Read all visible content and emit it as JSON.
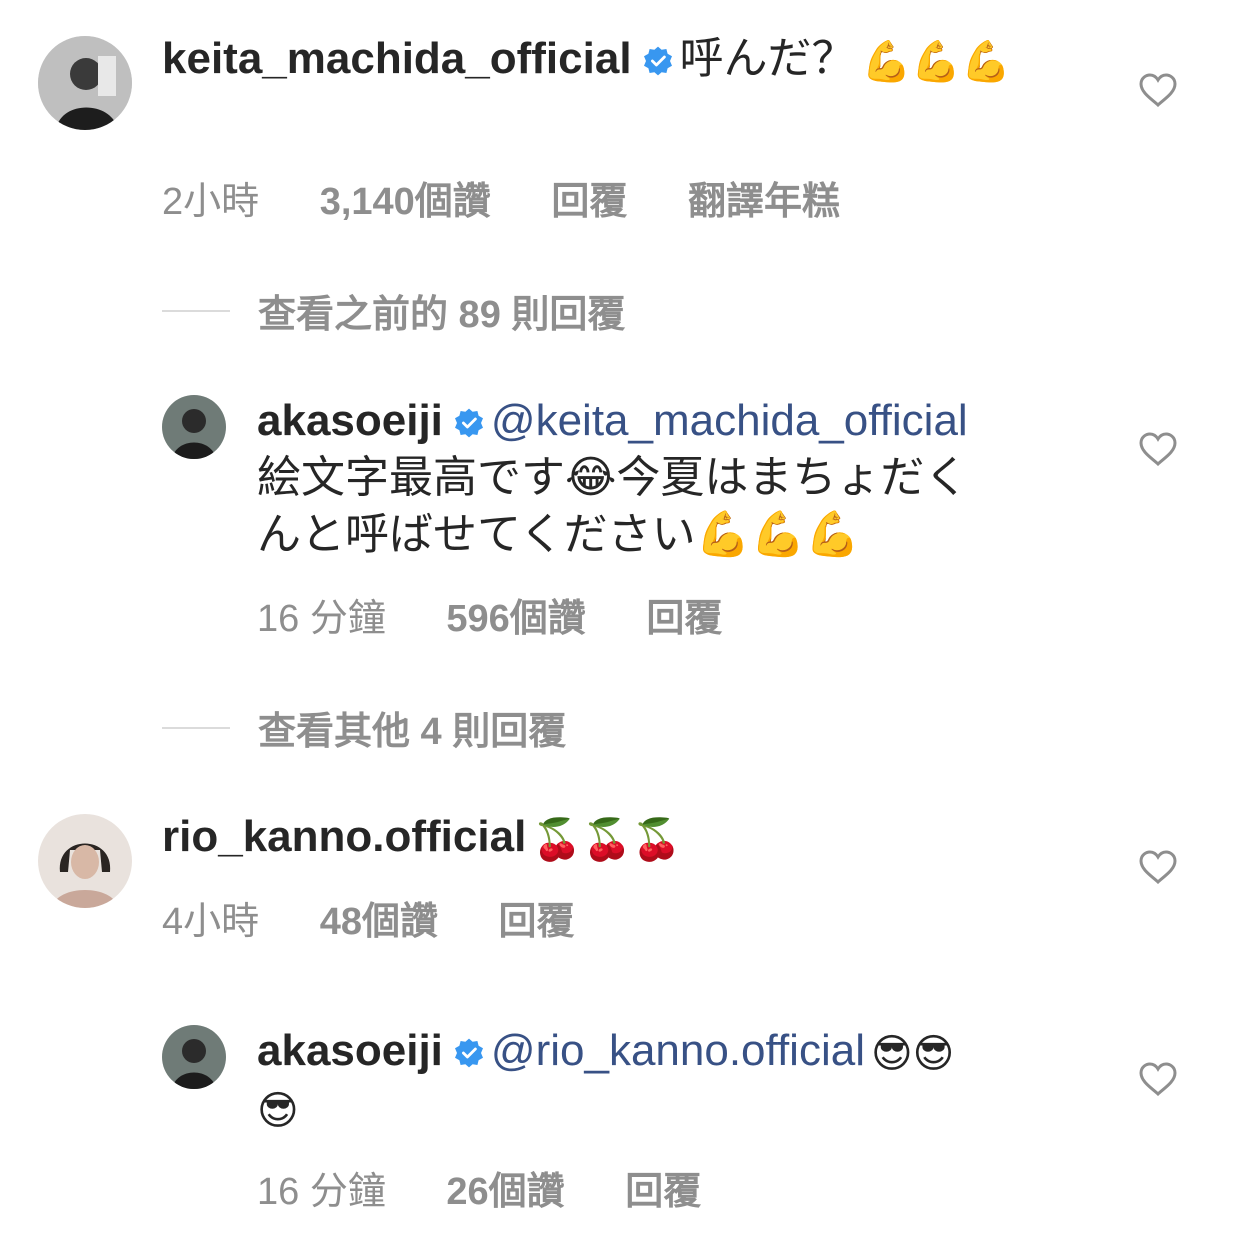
{
  "comments": [
    {
      "username": "keita_machida_official",
      "verified": true,
      "text": "呼んだ？",
      "emojis": "💪💪💪",
      "time": "2小時",
      "likes": "3,140個讚",
      "reply": "回覆",
      "translate": "翻譯年糕",
      "heart_icon": "heart-outline-icon"
    },
    {
      "view_replies": "查看之前的 89 則回覆"
    },
    {
      "username": "akasoeiji",
      "verified": true,
      "mention": "@keita_machida_official",
      "text_line1": "絵文字最高です😂今夏はまちょだく",
      "text_line2": "んと呼ばせてください💪💪💪",
      "time": "16 分鐘",
      "likes": "596個讚",
      "reply": "回覆"
    },
    {
      "view_replies": "查看其他 4 則回覆"
    },
    {
      "username": "rio_kanno.official",
      "verified": false,
      "emojis": "🍒🍒🍒",
      "time": "4小時",
      "likes": "48個讚",
      "reply": "回覆"
    },
    {
      "username": "akasoeiji",
      "verified": true,
      "mention": "@rio_kanno.official",
      "emojis_line1": "😎😎",
      "emojis_line2": "😎",
      "time": "16 分鐘",
      "likes": "26個讚",
      "reply": "回覆"
    }
  ],
  "colors": {
    "text": "#262626",
    "meta": "#8e8e8e",
    "mention": "#385185",
    "verified": "#3897f0",
    "divider": "#dbdbdb"
  }
}
